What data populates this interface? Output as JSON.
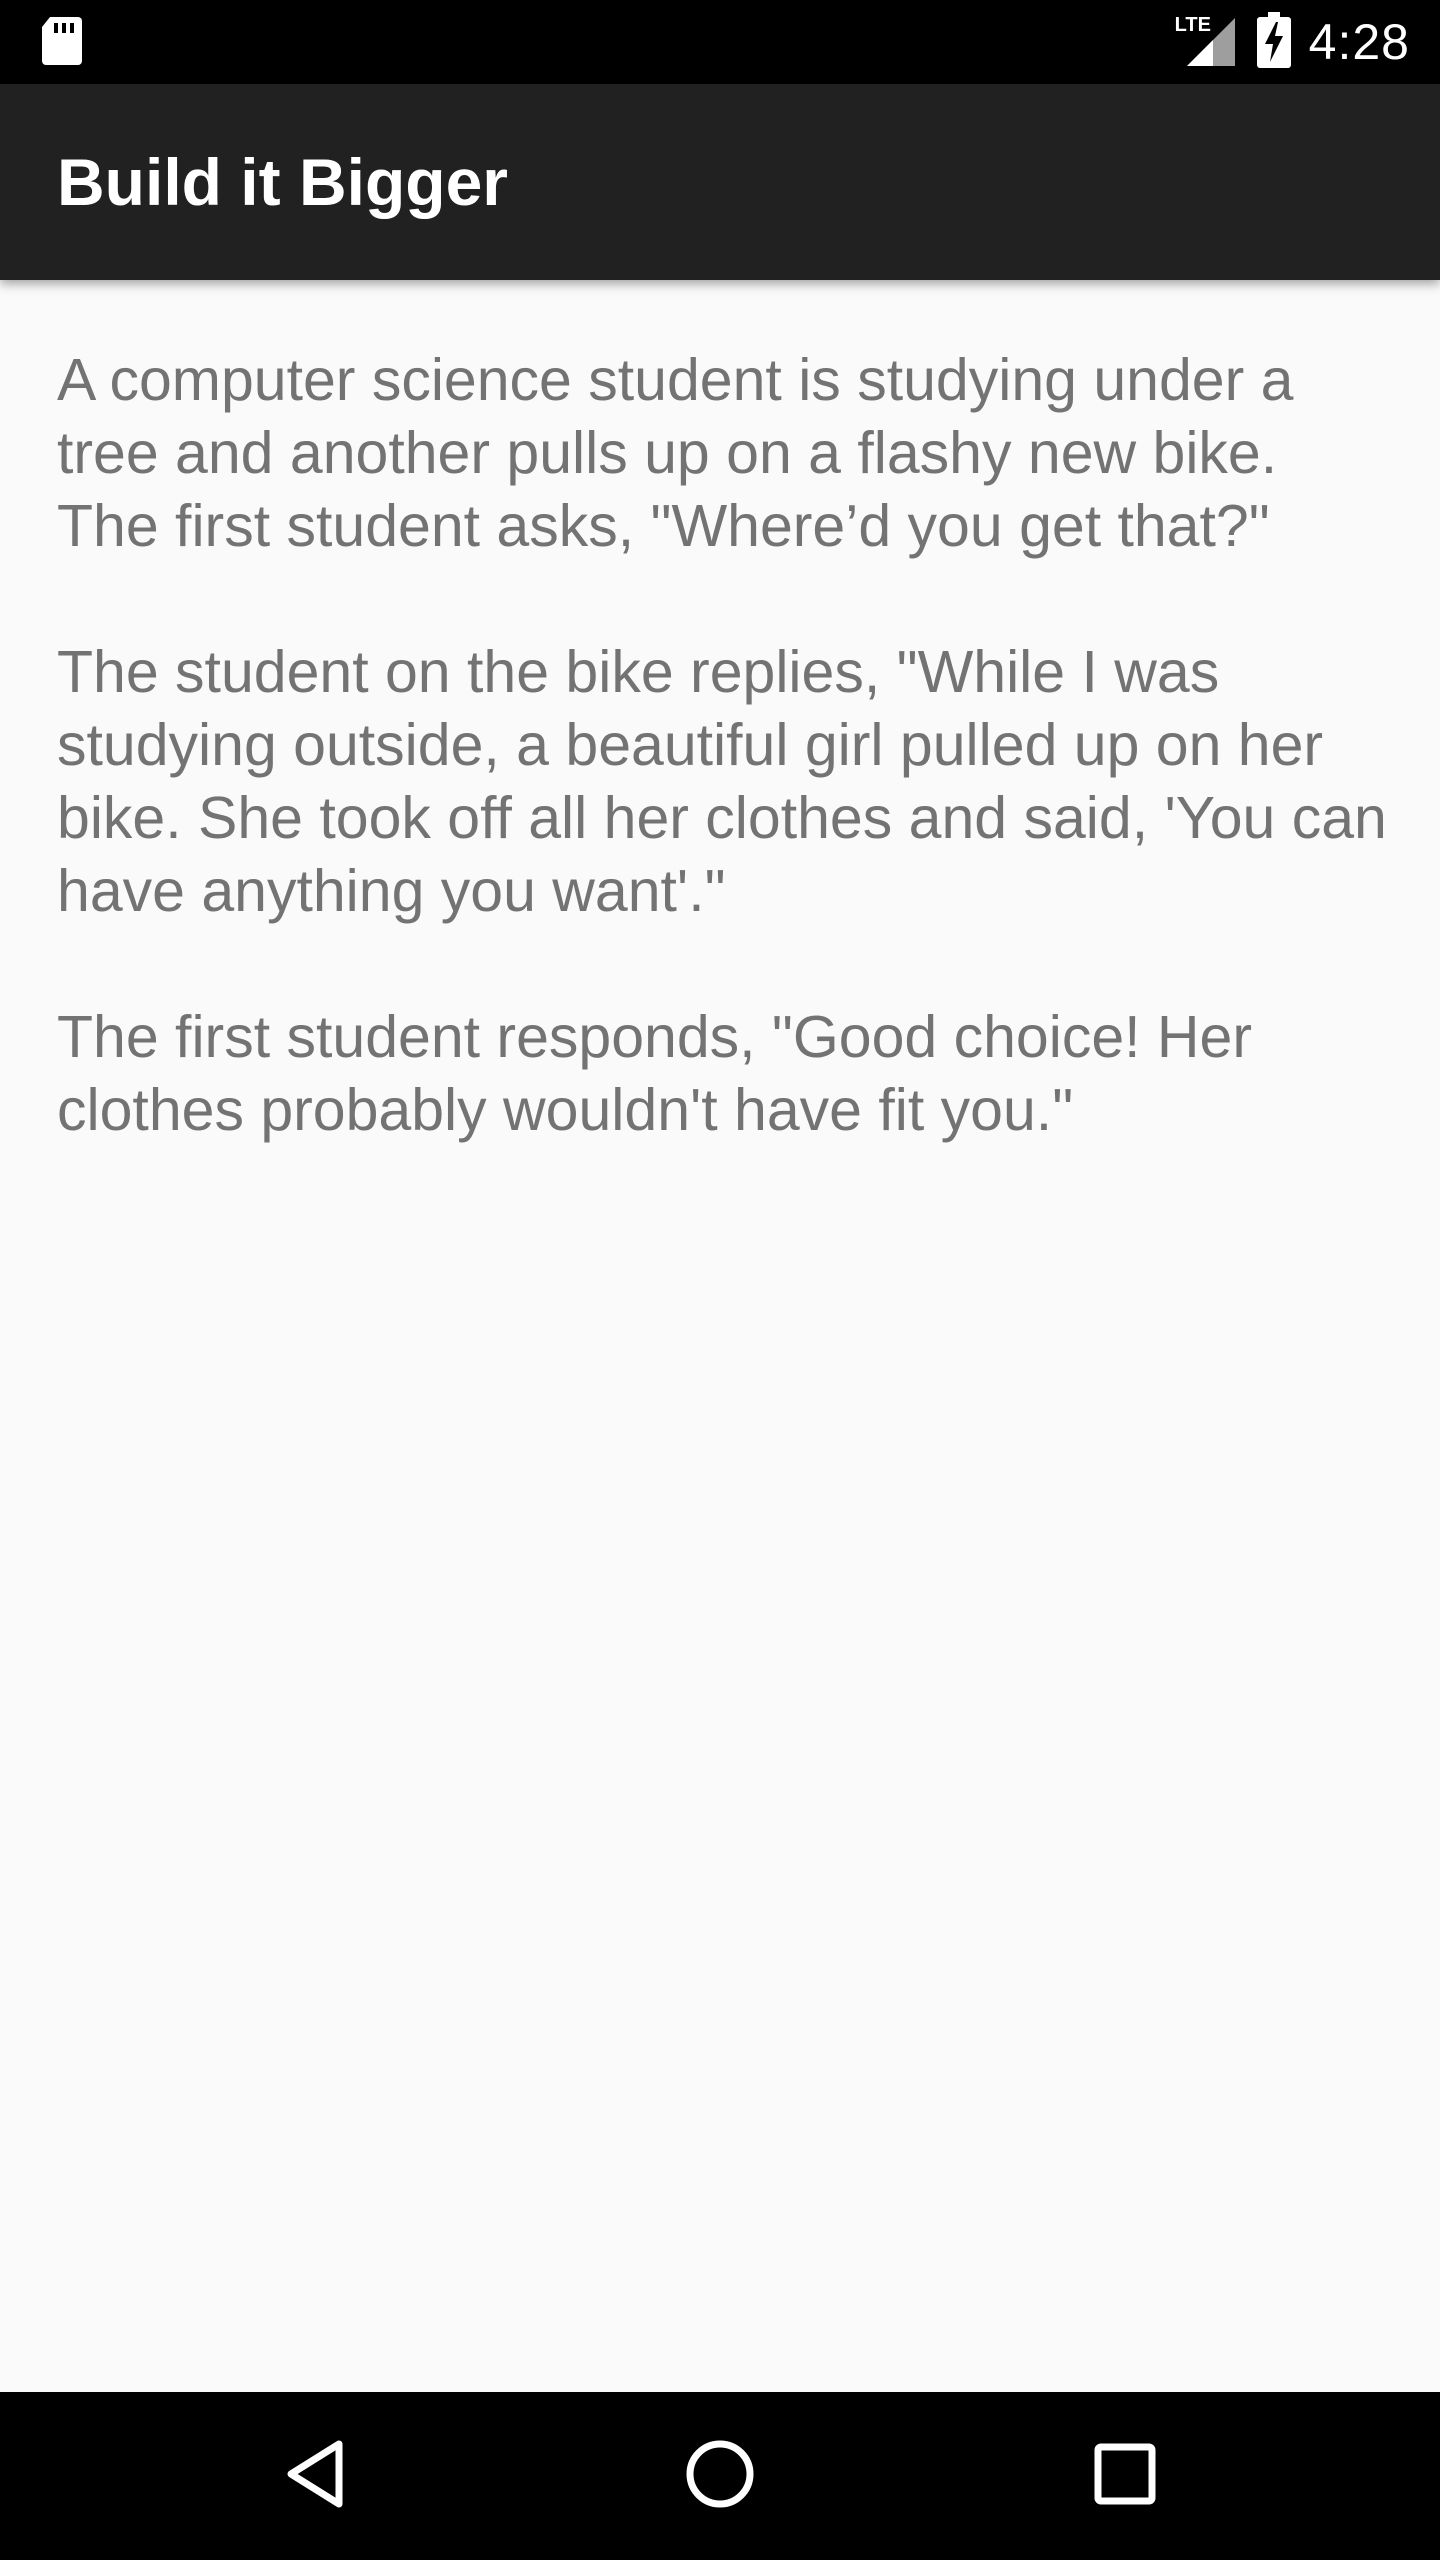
{
  "status_bar": {
    "time": "4:28",
    "network_label": "LTE",
    "icons": [
      "sd-card-icon",
      "lte-signal-icon",
      "battery-charging-icon"
    ]
  },
  "app_bar": {
    "title": "Build it Bigger"
  },
  "joke": {
    "text": "A computer science student is studying under a tree and another pulls up on a flashy new bike. The first student asks, \"Where’d you get that?\"\n\nThe student on the bike replies, \"While I was studying outside, a beautiful girl pulled up on her bike. She took off all her clothes and said, 'You can have anything you want'.\"\n\nThe first student responds, \"Good choice! Her clothes probably wouldn't have fit you.\""
  },
  "nav_bar": {
    "icons": [
      "back-icon",
      "home-icon",
      "recents-icon"
    ]
  },
  "colors": {
    "status_bar": "#000000",
    "app_bar": "#212121",
    "background": "#fafafa",
    "body_text": "#737373",
    "nav_bar": "#000000"
  }
}
